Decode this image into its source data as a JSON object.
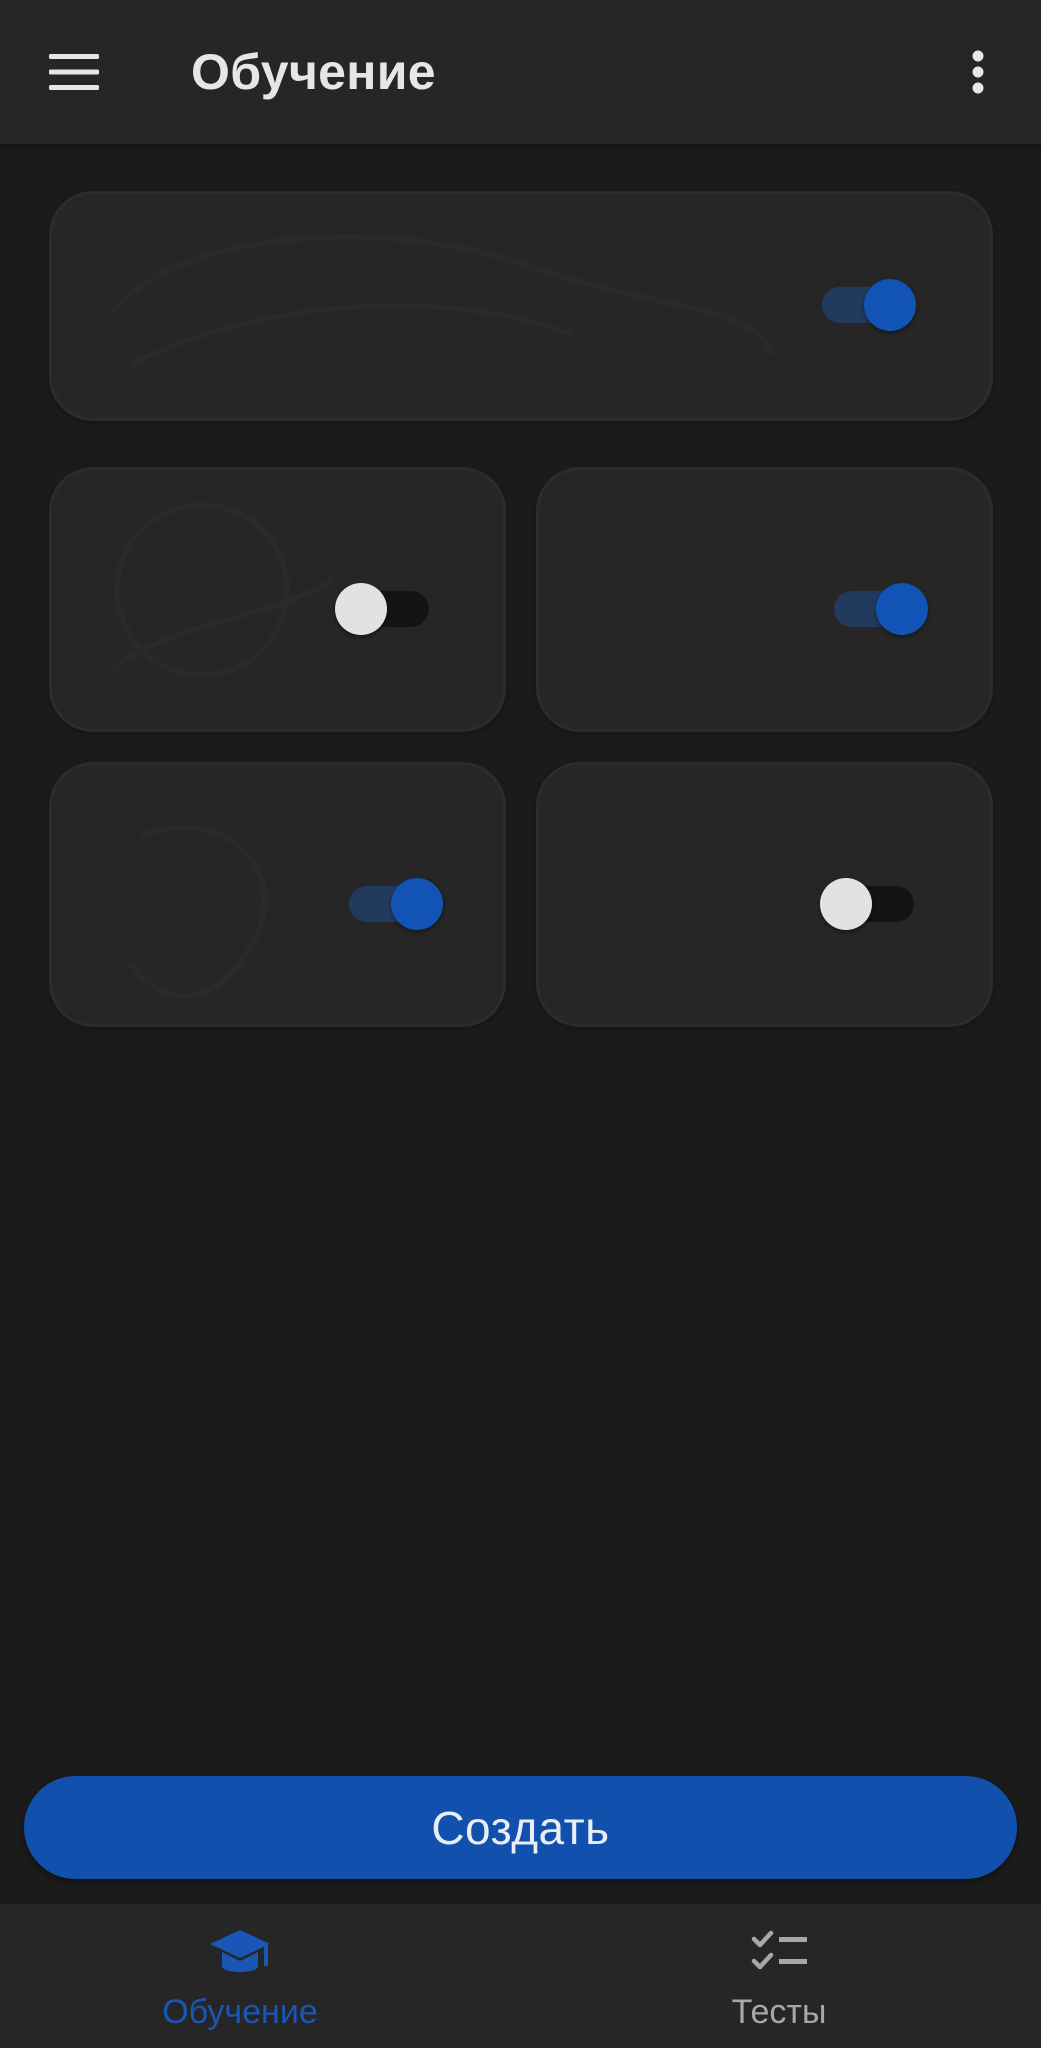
{
  "app_bar": {
    "title": "Обучение",
    "menu_icon": "hamburger-menu-icon",
    "overflow_icon": "more-vert-icon"
  },
  "cards": [
    {
      "id": "card-1",
      "switch_on": true
    },
    {
      "id": "card-2",
      "switch_on": false
    },
    {
      "id": "card-3",
      "switch_on": true
    },
    {
      "id": "card-4",
      "switch_on": true
    },
    {
      "id": "card-5",
      "switch_on": false
    }
  ],
  "actions": {
    "create_label": "Создать"
  },
  "bottom_nav": {
    "items": [
      {
        "label": "Обучение",
        "icon": "graduation-cap-icon",
        "active": true
      },
      {
        "label": "Тесты",
        "icon": "checklist-icon",
        "active": false
      }
    ]
  },
  "colors": {
    "background": "#1b1b1b",
    "surface": "#262626",
    "accent": "#1150ac",
    "switch_thumb_on": "#1253b6",
    "switch_thumb_off": "#e2e2e2",
    "text_primary": "#e6e6e6",
    "text_inactive": "#a8a8a8"
  }
}
